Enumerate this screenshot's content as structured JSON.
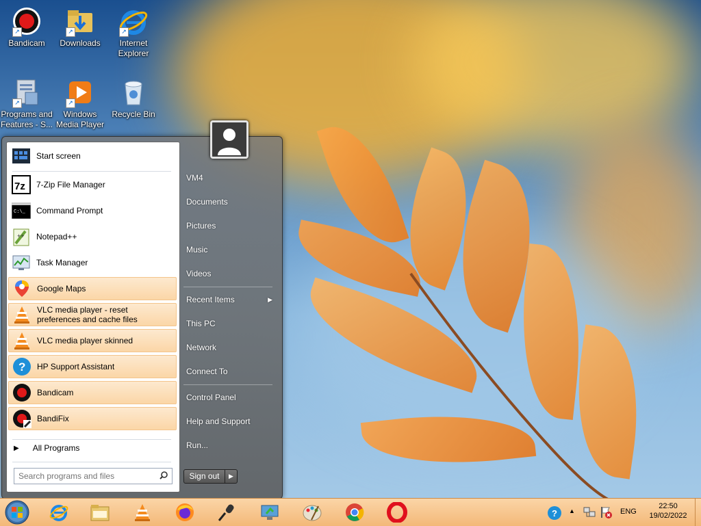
{
  "desktop": {
    "icons": [
      {
        "label": "Bandicam"
      },
      {
        "label": "Downloads"
      },
      {
        "label_line1": "Internet",
        "label_line2": "Explorer"
      },
      {
        "label_line1": "Programs and",
        "label_line2": "Features - S..."
      },
      {
        "label_line1": "Windows",
        "label_line2": "Media Player"
      },
      {
        "label": "Recycle Bin"
      }
    ]
  },
  "start_menu": {
    "pinned": [
      {
        "label": "Start screen",
        "icon": "start-screen-icon"
      }
    ],
    "programs": [
      {
        "label": "7-Zip File Manager",
        "icon": "7zip-icon",
        "highlighted": false
      },
      {
        "label": "Command Prompt",
        "icon": "cmd-icon",
        "highlighted": false
      },
      {
        "label": "Notepad++",
        "icon": "notepadpp-icon",
        "highlighted": false
      },
      {
        "label": "Task Manager",
        "icon": "task-manager-icon",
        "highlighted": false
      },
      {
        "label": "Google Maps",
        "icon": "google-maps-icon",
        "highlighted": true
      },
      {
        "label_line1": "VLC media player - reset",
        "label_line2": "preferences and cache files",
        "icon": "vlc-icon",
        "highlighted": true
      },
      {
        "label": "VLC media player skinned",
        "icon": "vlc-icon",
        "highlighted": true
      },
      {
        "label": "HP Support Assistant",
        "icon": "help-icon",
        "highlighted": true
      },
      {
        "label": "Bandicam",
        "icon": "bandicam-icon",
        "highlighted": true
      },
      {
        "label": "BandiFix",
        "icon": "bandifix-icon",
        "highlighted": true
      }
    ],
    "all_programs": "All Programs",
    "search_placeholder": "Search programs and files",
    "right_items": [
      {
        "label": "VM4"
      },
      {
        "label": "Documents"
      },
      {
        "label": "Pictures"
      },
      {
        "label": "Music"
      },
      {
        "label": "Videos"
      },
      {
        "label": "Recent Items"
      },
      {
        "label": "This PC"
      },
      {
        "label": "Network"
      },
      {
        "label": "Connect To"
      },
      {
        "label": "Control Panel"
      },
      {
        "label": "Help and Support"
      },
      {
        "label": "Run..."
      }
    ],
    "sign_out": "Sign out"
  },
  "taskbar": {
    "pinned": [
      "start-orb-icon",
      "internet-explorer-icon",
      "file-explorer-icon",
      "vlc-icon",
      "firefox-icon",
      "microphone-icon",
      "monitor-icon",
      "paint-icon",
      "chrome-icon",
      "opera-icon"
    ],
    "tray": {
      "language": "ENG",
      "time": "22:50",
      "date": "19/02/2022"
    }
  },
  "colors": {
    "highlight_bg": "#fbd6a7",
    "taskbar_bg": "#f3b878",
    "leaf_orange": "#f2902e"
  }
}
